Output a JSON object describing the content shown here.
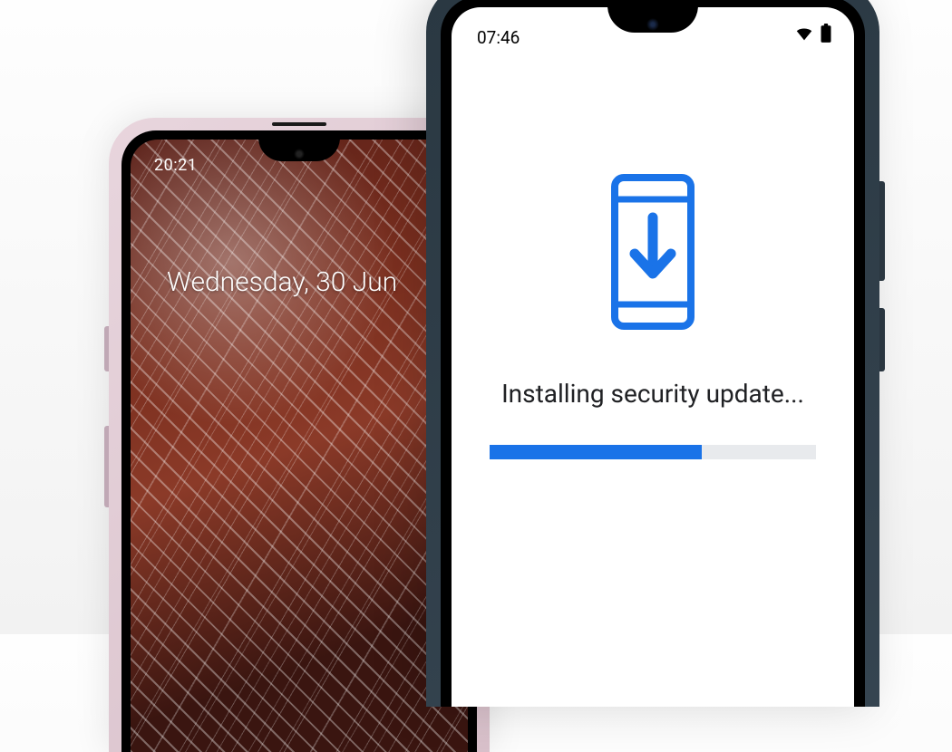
{
  "phone_left": {
    "status_time": "20:21",
    "lock_date": "Wednesday, 30 Jun"
  },
  "phone_right": {
    "status_time": "07:46",
    "update_message": "Installing security update...",
    "progress_percent": 65
  },
  "colors": {
    "progress_fill": "#1a73e8",
    "progress_track": "#e8eaed"
  }
}
